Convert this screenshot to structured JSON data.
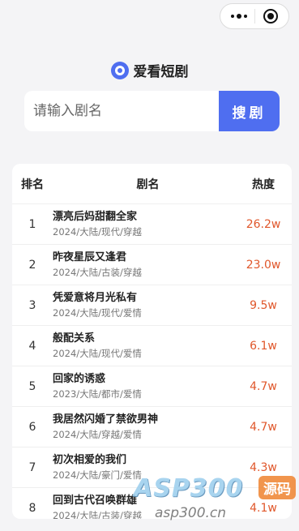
{
  "brand": {
    "name": "爱看短剧",
    "logo_icon": "play-circle-icon",
    "color": "#4f6ef0"
  },
  "search": {
    "placeholder": "请输入剧名",
    "button_label": "搜剧"
  },
  "table": {
    "headers": {
      "rank": "排名",
      "title": "剧名",
      "heat": "热度"
    },
    "rows": [
      {
        "rank": "1",
        "title": "漂亮后妈甜翻全家",
        "meta": "2024/大陆/现代/穿越",
        "heat": "26.2w"
      },
      {
        "rank": "2",
        "title": "昨夜星辰又逢君",
        "meta": "2024/大陆/古装/穿越",
        "heat": "23.0w"
      },
      {
        "rank": "3",
        "title": "凭爱意将月光私有",
        "meta": "2024/大陆/现代/爱情",
        "heat": "9.5w"
      },
      {
        "rank": "4",
        "title": "般配关系",
        "meta": "2024/大陆/现代/爱情",
        "heat": "6.1w"
      },
      {
        "rank": "5",
        "title": "回家的诱惑",
        "meta": "2023/大陆/都市/爱情",
        "heat": "4.7w"
      },
      {
        "rank": "6",
        "title": "我居然闪婚了禁欲男神",
        "meta": "2024/大陆/穿越/爱情",
        "heat": "4.7w"
      },
      {
        "rank": "7",
        "title": "初次相爱的我们",
        "meta": "2024/大陆/豪门/爱情",
        "heat": "4.3w"
      },
      {
        "rank": "8",
        "title": "回到古代召唤群雄",
        "meta": "2024/大陆/古装/穿越",
        "heat": "4.1w"
      }
    ],
    "heat_color": "#e0572b"
  },
  "watermark": {
    "big": "ASP300",
    "tag": "源码",
    "url": "asp300.cn"
  }
}
